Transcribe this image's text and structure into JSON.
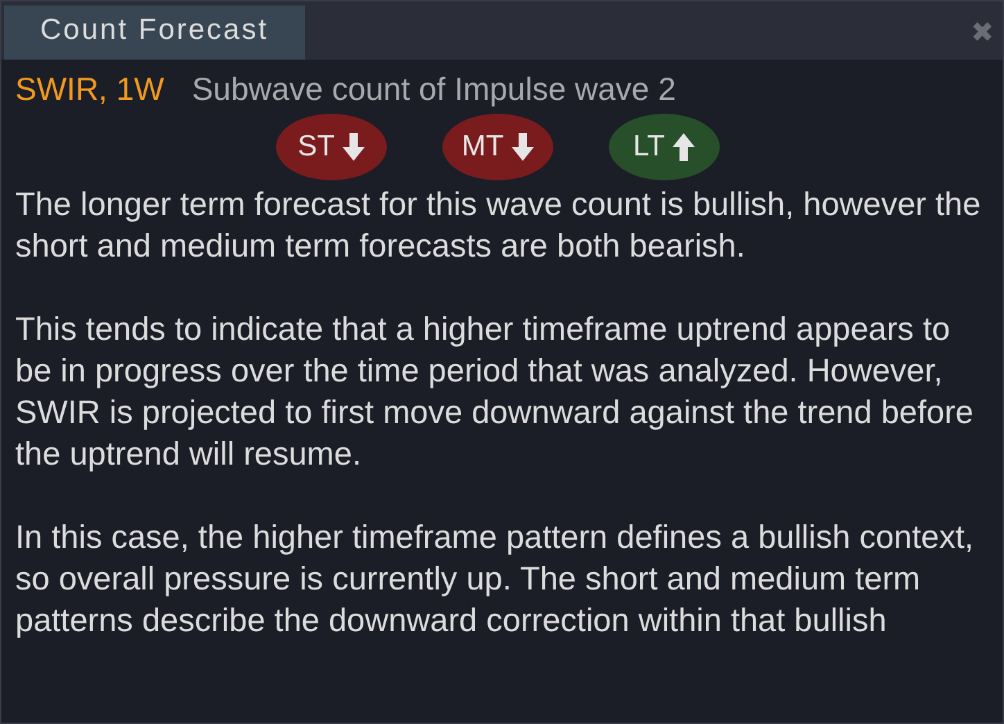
{
  "window": {
    "title": "Count Forecast",
    "close": "✖"
  },
  "header": {
    "symbol": "SWIR, 1W",
    "subtitle": "Subwave count of Impulse wave 2"
  },
  "forecasts": [
    {
      "label": "ST",
      "up": false
    },
    {
      "label": "MT",
      "up": false
    },
    {
      "label": "LT",
      "up": true
    }
  ],
  "paragraphs": [
    "The longer term forecast for this wave count is bullish, however the short and medium term forecasts are both bearish.",
    "This tends to indicate that a higher timeframe uptrend appears to be in progress over the time period that was analyzed. However, SWIR is projected to first move downward against the trend before the uptrend will resume.",
    "In this case, the higher timeframe pattern defines a bullish context, so overall pressure is currently up. The short and medium term patterns describe the downward correction within that bullish"
  ]
}
